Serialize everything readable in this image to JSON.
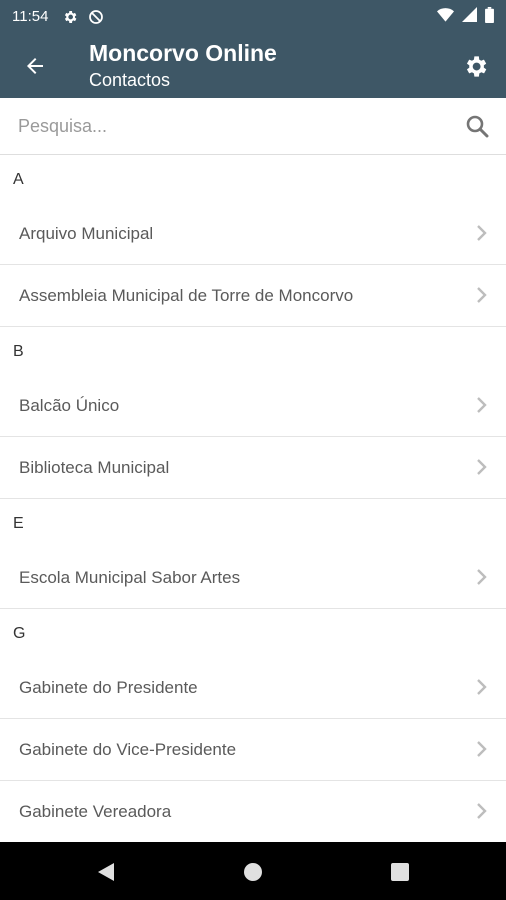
{
  "status_bar": {
    "time": "11:54",
    "icons": [
      "settings-gear-icon",
      "no-data-icon",
      "wifi-icon",
      "signal-icon",
      "battery-icon"
    ]
  },
  "app_bar": {
    "title": "Moncorvo Online",
    "subtitle": "Contactos",
    "background_color": "#3e5766"
  },
  "search": {
    "placeholder": "Pesquisa..."
  },
  "sections": [
    {
      "letter": "A",
      "items": [
        "Arquivo Municipal",
        "Assembleia Municipal de Torre de Moncorvo"
      ]
    },
    {
      "letter": "B",
      "items": [
        "Balcão Único",
        "Biblioteca Municipal"
      ]
    },
    {
      "letter": "E",
      "items": [
        "Escola Municipal Sabor Artes"
      ]
    },
    {
      "letter": "G",
      "items": [
        "Gabinete do Presidente",
        "Gabinete do Vice-Presidente",
        "Gabinete Vereadora"
      ]
    }
  ],
  "nav_bar": {
    "buttons": [
      "back-triangle-icon",
      "home-circle-icon",
      "recents-square-icon"
    ]
  }
}
